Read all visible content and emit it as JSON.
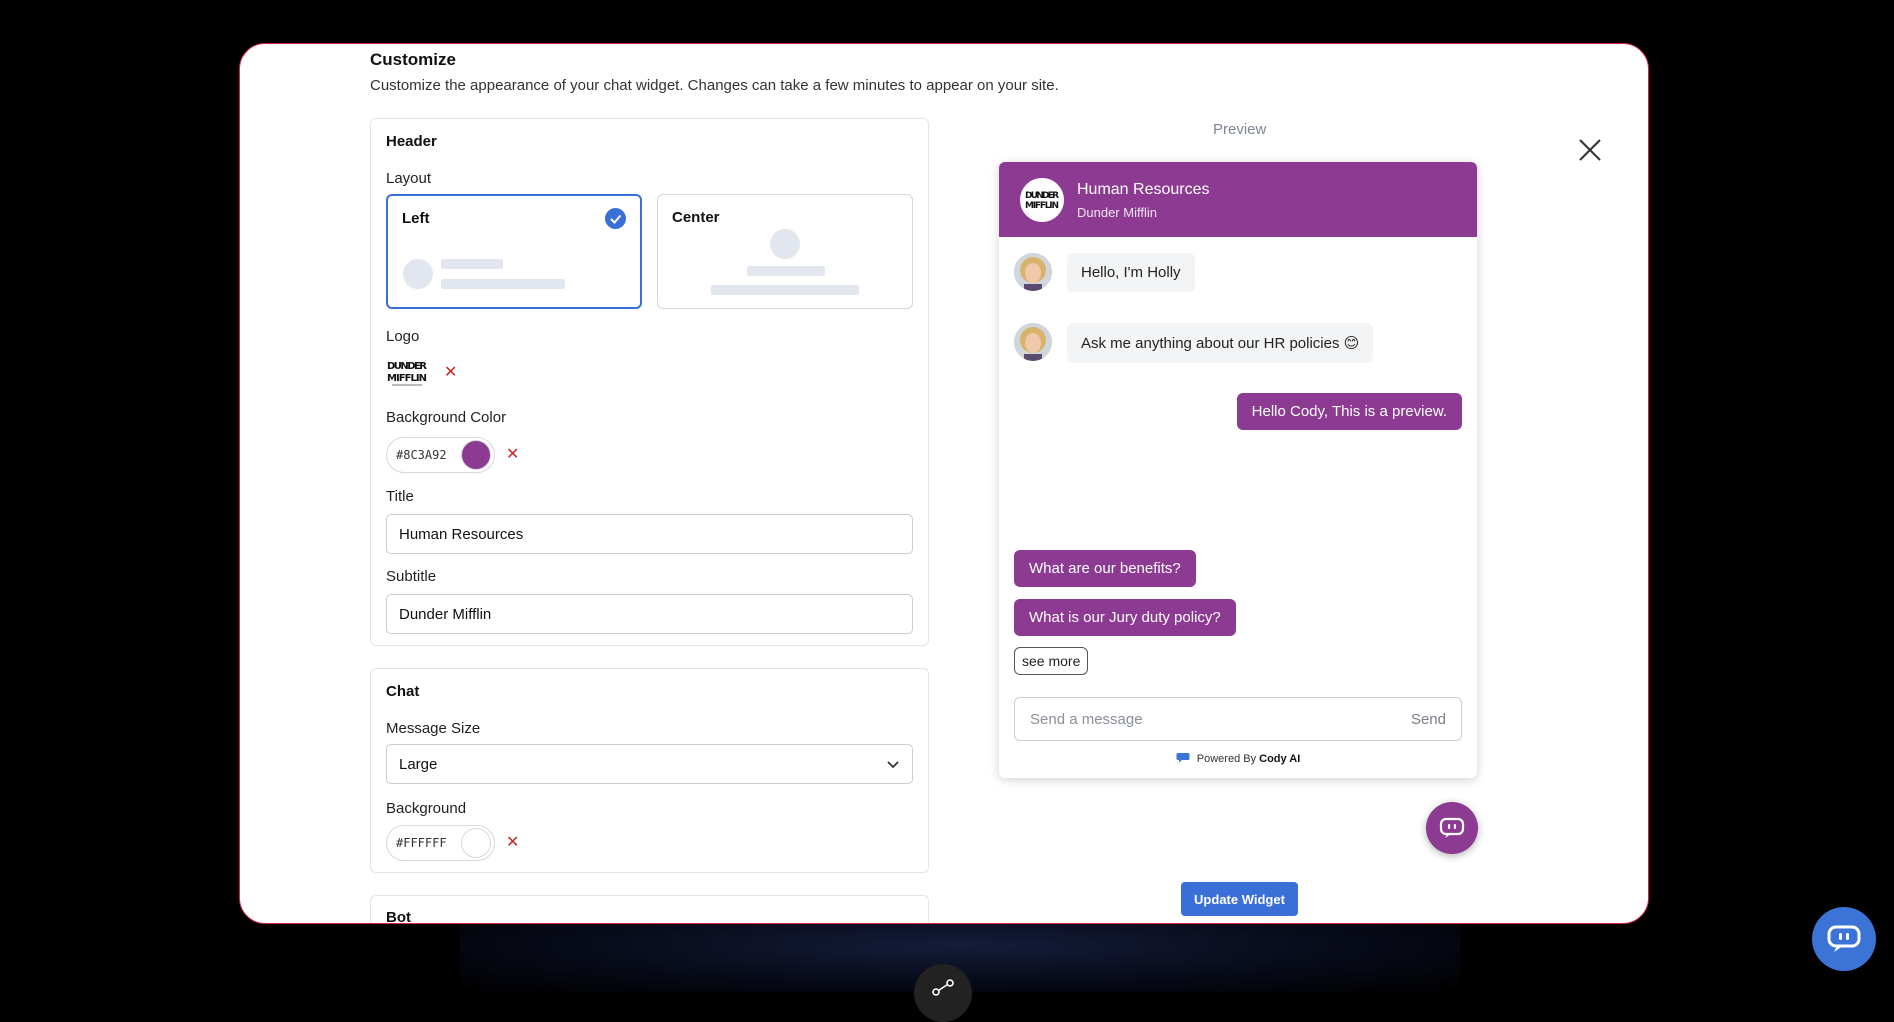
{
  "colors": {
    "accent": "#8C3A92",
    "primary_blue": "#3B6FD8"
  },
  "customize": {
    "title": "Customize",
    "description": "Customize the appearance of your chat widget. Changes can take a few minutes to appear on your site."
  },
  "header_section": {
    "title": "Header",
    "layout_label": "Layout",
    "layout_options": [
      {
        "label": "Left",
        "selected": true
      },
      {
        "label": "Center",
        "selected": false
      }
    ],
    "logo_label": "Logo",
    "logo_alt": "DUNDER MIFFLIN",
    "bg_color_label": "Background Color",
    "bg_color_value": "#8C3A92",
    "title_label": "Title",
    "title_value": "Human Resources",
    "subtitle_label": "Subtitle",
    "subtitle_value": "Dunder Mifflin"
  },
  "chat_section": {
    "title": "Chat",
    "message_size_label": "Message Size",
    "message_size_value": "Large",
    "background_label": "Background",
    "background_value": "#FFFFFF"
  },
  "bot_section": {
    "title": "Bot"
  },
  "preview": {
    "label": "Preview",
    "header_title": "Human Resources",
    "header_subtitle": "Dunder Mifflin",
    "bot_messages": [
      "Hello, I'm Holly",
      "Ask me anything about our HR policies 😊"
    ],
    "user_message": "Hello Cody, This is a preview.",
    "suggestions": [
      "What are our benefits?",
      "What is our Jury duty policy?"
    ],
    "see_more": "see more",
    "input_placeholder": "Send a message",
    "send_label": "Send",
    "powered_by": "Powered By",
    "powered_brand": "Cody AI"
  },
  "update_button": "Update Widget",
  "icons": {
    "close": "close-icon",
    "check": "check-icon",
    "chevron": "chevron-down-icon",
    "remove": "remove-icon",
    "chat_launcher": "chat-bot-icon",
    "share": "share-icon"
  }
}
